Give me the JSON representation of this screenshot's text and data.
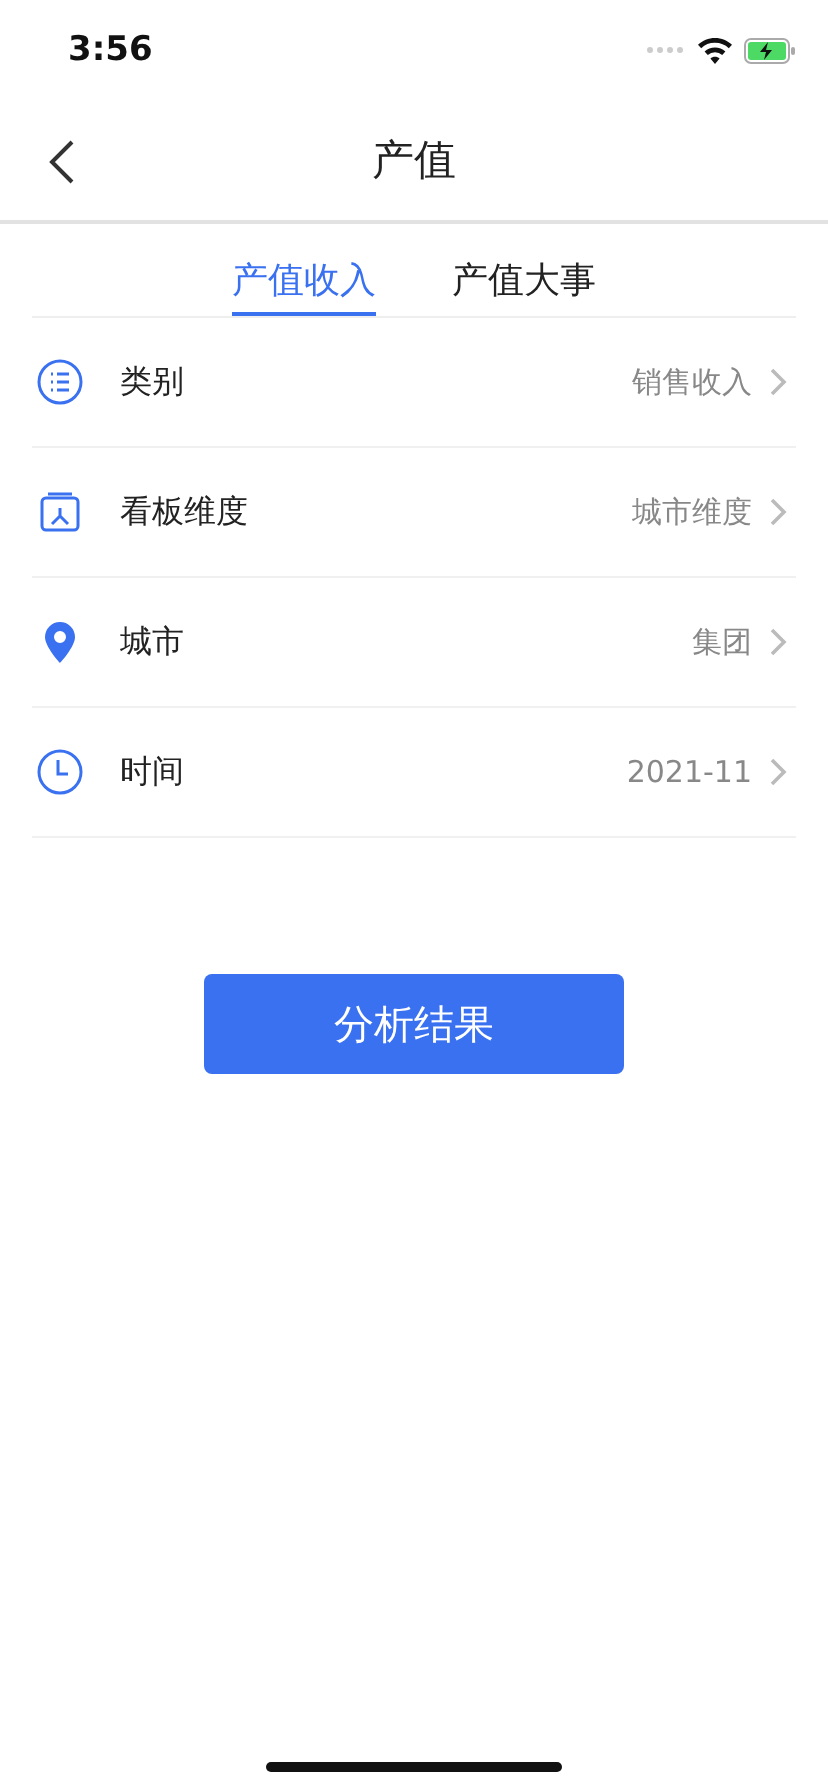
{
  "status_bar": {
    "time": "3:56"
  },
  "nav": {
    "title": "产值"
  },
  "tabs": [
    {
      "label": "产值收入",
      "selected": true
    },
    {
      "label": "产值大事",
      "selected": false
    }
  ],
  "rows": [
    {
      "kind": "list",
      "label": "类别",
      "value": "销售收入"
    },
    {
      "kind": "board",
      "label": "看板维度",
      "value": "城市维度"
    },
    {
      "kind": "pin",
      "label": "城市",
      "value": "集团"
    },
    {
      "kind": "clock",
      "label": "时间",
      "value": "2021-11"
    }
  ],
  "button": {
    "label": "分析结果"
  }
}
